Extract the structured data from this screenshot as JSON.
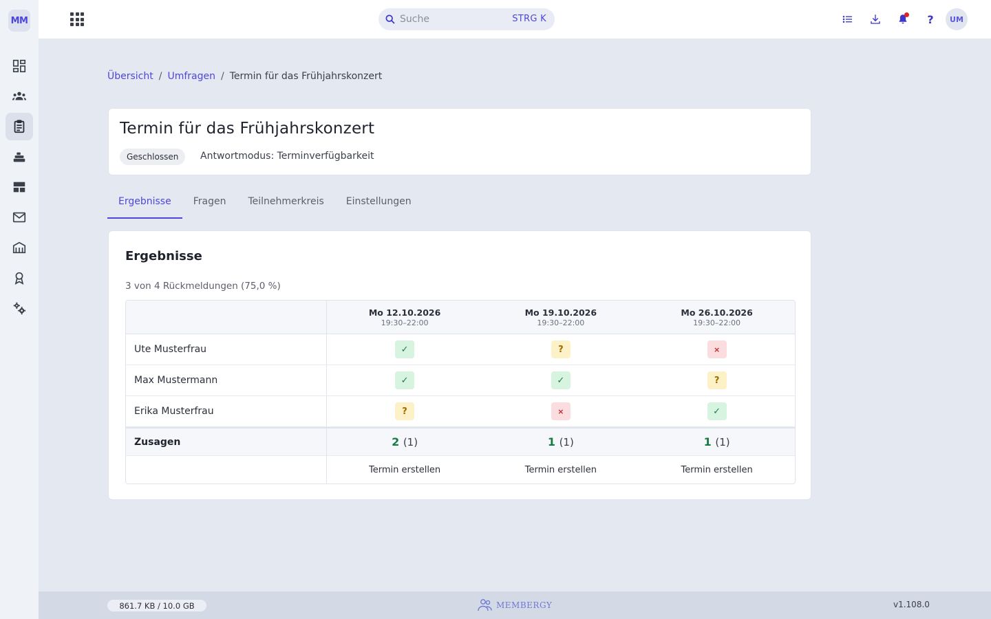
{
  "sidebar": {
    "logo": "MM",
    "items": [
      {
        "icon": "dashboard-icon",
        "active": false
      },
      {
        "icon": "members-icon",
        "active": false
      },
      {
        "icon": "clipboard-icon",
        "active": true
      },
      {
        "icon": "inventory-icon",
        "active": false
      },
      {
        "icon": "table-icon",
        "active": false
      },
      {
        "icon": "mail-icon",
        "active": false
      },
      {
        "icon": "building-icon",
        "active": false
      },
      {
        "icon": "award-icon",
        "active": false
      },
      {
        "icon": "settings-icon",
        "active": false
      }
    ]
  },
  "topbar": {
    "search_placeholder": "Suche",
    "search_shortcut": "STRG K",
    "help": "?",
    "avatar": "UM"
  },
  "breadcrumb": {
    "items": [
      "Übersicht",
      "Umfragen"
    ],
    "separator": "/",
    "current": "Termin für das Frühjahrskonzert"
  },
  "survey": {
    "title": "Termin für das Frühjahrskonzert",
    "status": "Geschlossen",
    "mode": "Antwortmodus: Terminverfügbarkeit"
  },
  "tabs": [
    {
      "label": "Ergebnisse",
      "active": true
    },
    {
      "label": "Fragen",
      "active": false
    },
    {
      "label": "Teilnehmerkreis",
      "active": false
    },
    {
      "label": "Einstellungen",
      "active": false
    }
  ],
  "results": {
    "heading": "Ergebnisse",
    "summary": "3 von 4 Rückmeldungen (75,0 %)",
    "dates": [
      {
        "date": "Mo 12.10.2026",
        "time": "19:30–22:00"
      },
      {
        "date": "Mo 19.10.2026",
        "time": "19:30–22:00"
      },
      {
        "date": "Mo 26.10.2026",
        "time": "19:30–22:00"
      }
    ],
    "rows": [
      {
        "name": "Ute Musterfrau",
        "answers": [
          "✓",
          "?",
          "×"
        ]
      },
      {
        "name": "Max Mustermann",
        "answers": [
          "✓",
          "✓",
          "?"
        ]
      },
      {
        "name": "Erika Musterfrau",
        "answers": [
          "?",
          "×",
          "✓"
        ]
      }
    ],
    "totals_label": "Zusagen",
    "totals": [
      {
        "count": "2",
        "maybe": "(1)"
      },
      {
        "count": "1",
        "maybe": "(1)"
      },
      {
        "count": "1",
        "maybe": "(1)"
      }
    ],
    "action_label": "Termin erstellen"
  },
  "footer": {
    "storage": "861.7 KB / 10.0 GB",
    "brand": "MEMBERGY",
    "version": "v1.108.0"
  },
  "colors": {
    "accent": "#4e46dc",
    "yes": "#1b7a44",
    "maybe": "#a36a00",
    "no": "#c62828"
  }
}
